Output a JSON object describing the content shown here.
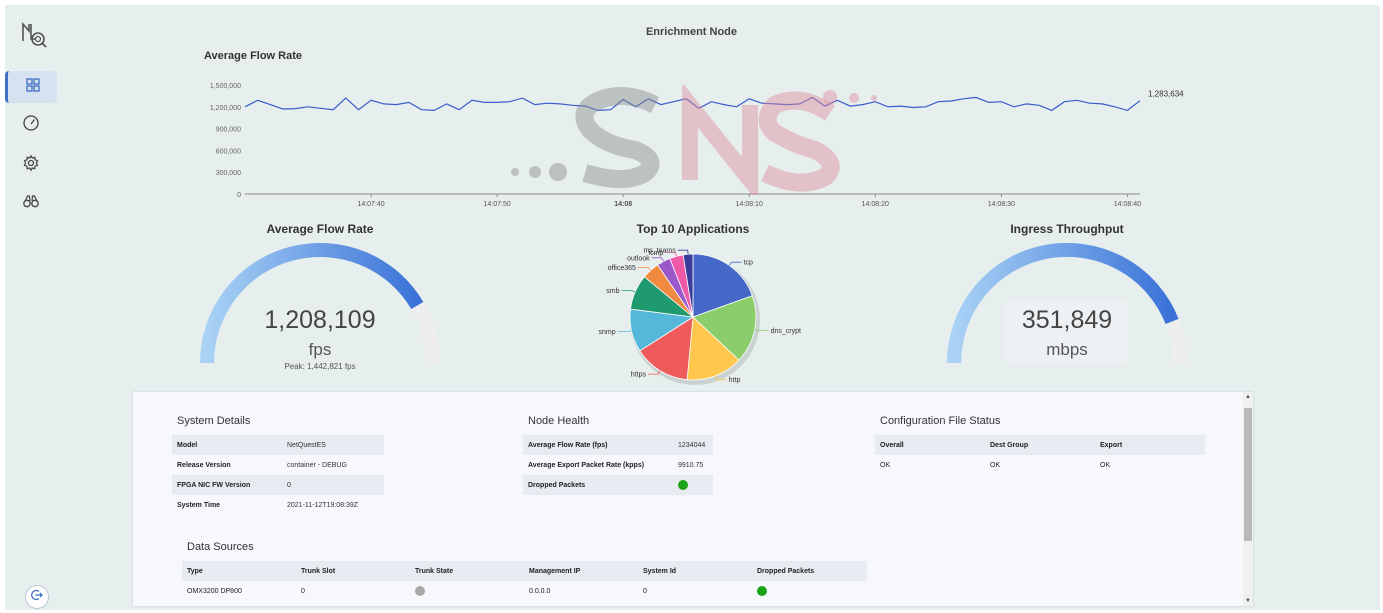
{
  "page": {
    "title": "Enrichment Node"
  },
  "sidebar": {
    "items": [
      {
        "name": "dashboard",
        "icon": "grid-icon",
        "active": true
      },
      {
        "name": "performance",
        "icon": "speedometer-icon",
        "active": false
      },
      {
        "name": "settings",
        "icon": "gear-icon",
        "active": false
      },
      {
        "name": "monitor",
        "icon": "binoculars-icon",
        "active": false
      }
    ],
    "logo_icon": "netquest-logo-icon",
    "logout_icon": "logout-icon"
  },
  "flow_chart": {
    "title": "Average Flow Rate",
    "y_ticks": [
      "1,500,000",
      "1,200,000",
      "900,000",
      "600,000",
      "300,000",
      "0"
    ],
    "x_ticks": [
      "14:07:40",
      "14:07:50",
      "14:08",
      "14:08:10",
      "14:08:20",
      "14:08:30",
      "14:08:40"
    ],
    "last_value_label": "1,283,634",
    "color": "#3b5ccc"
  },
  "chart_data": [
    {
      "type": "line",
      "title": "Average Flow Rate",
      "ylim": [
        0,
        1500000
      ],
      "x": [
        "14:07:30",
        "14:07:31",
        "14:07:32",
        "14:07:33",
        "14:07:34",
        "14:07:35",
        "14:07:36",
        "14:07:37",
        "14:07:38",
        "14:07:39",
        "14:07:40",
        "14:07:41",
        "14:07:42",
        "14:07:43",
        "14:07:44",
        "14:07:45",
        "14:07:46",
        "14:07:47",
        "14:07:48",
        "14:07:49",
        "14:07:50",
        "14:07:51",
        "14:07:52",
        "14:07:53",
        "14:07:54",
        "14:07:55",
        "14:07:56",
        "14:07:57",
        "14:07:58",
        "14:07:59",
        "14:08:00",
        "14:08:01",
        "14:08:02",
        "14:08:03",
        "14:08:04",
        "14:08:05",
        "14:08:06",
        "14:08:07",
        "14:08:08",
        "14:08:09",
        "14:08:10",
        "14:08:11",
        "14:08:12",
        "14:08:13",
        "14:08:14",
        "14:08:15",
        "14:08:16",
        "14:08:17",
        "14:08:18",
        "14:08:19",
        "14:08:20",
        "14:08:21",
        "14:08:22",
        "14:08:23",
        "14:08:24",
        "14:08:25",
        "14:08:26",
        "14:08:27",
        "14:08:28",
        "14:08:29",
        "14:08:30",
        "14:08:31",
        "14:08:32",
        "14:08:33",
        "14:08:34",
        "14:08:35",
        "14:08:36",
        "14:08:37",
        "14:08:38",
        "14:08:39",
        "14:08:40",
        "14:08:41"
      ],
      "series": [
        {
          "values": [
            1200000,
            1290000,
            1230000,
            1170000,
            1175000,
            1200000,
            1180000,
            1160000,
            1320000,
            1160000,
            1290000,
            1240000,
            1230000,
            1260000,
            1160000,
            1150000,
            1240000,
            1160000,
            1290000,
            1260000,
            1260000,
            1270000,
            1320000,
            1230000,
            1250000,
            1240000,
            1220000,
            1210000,
            1150000,
            1160000,
            1300000,
            1200000,
            1310000,
            1230000,
            1270000,
            1310000,
            1180000,
            1270000,
            1230000,
            1200000,
            1310000,
            1250000,
            1240000,
            1230000,
            1240000,
            1330000,
            1210000,
            1290000,
            1210000,
            1230000,
            1270000,
            1200000,
            1210000,
            1190000,
            1200000,
            1270000,
            1280000,
            1310000,
            1330000,
            1260000,
            1270000,
            1200000,
            1240000,
            1220000,
            1150000,
            1270000,
            1290000,
            1250000,
            1240000,
            1200000,
            1150000,
            1283634
          ]
        }
      ]
    },
    {
      "type": "pie",
      "title": "Top 10 Applications",
      "categories": [
        "tcp",
        "dns_crypt",
        "http",
        "https",
        "snmp",
        "smb",
        "office365",
        "outlook",
        "icmp",
        "ms_teams"
      ],
      "values": [
        19.5,
        17.5,
        14.5,
        14.5,
        11,
        9,
        4.5,
        3.5,
        3.5,
        2.5
      ],
      "colors": [
        "#4567c8",
        "#8bcd6a",
        "#ffc74d",
        "#ef5a5a",
        "#56b8d8",
        "#1f9a6e",
        "#f08a40",
        "#9a58c8",
        "#ef5aa8",
        "#3b3b9a"
      ]
    }
  ],
  "gauges": {
    "flow": {
      "title": "Average Flow Rate",
      "value": "1,208,109",
      "unit": "fps",
      "peak": "Peak: 1,442,821 fps",
      "fraction": 0.83
    },
    "ingress": {
      "title": "Ingress Throughput",
      "value": "351,849",
      "unit": "mbps",
      "fraction": 0.88
    }
  },
  "system_details": {
    "title": "System Details",
    "rows": [
      {
        "key": "Model",
        "value": "NetQuestES"
      },
      {
        "key": "Release Version",
        "value": "container - DEBUG"
      },
      {
        "key": "FPGA NIC FW Version",
        "value": "0"
      },
      {
        "key": "System Time",
        "value": "2021-11-12T19:08:39Z"
      }
    ]
  },
  "node_health": {
    "title": "Node Health",
    "rows": [
      {
        "key": "Average Flow Rate (fps)",
        "value": "1234044"
      },
      {
        "key": "Average Export Packet Rate (kpps)",
        "value": "9910.75"
      },
      {
        "key": "Dropped Packets",
        "status_color": "#1ba31b"
      }
    ]
  },
  "config_status": {
    "title": "Configuration File Status",
    "headers": [
      "Overall",
      "Dest Group",
      "Export"
    ],
    "values": [
      "OK",
      "OK",
      "OK"
    ]
  },
  "data_sources": {
    "title": "Data Sources",
    "headers": [
      "Type",
      "Trunk Slot",
      "Trunk State",
      "Management IP",
      "System Id",
      "Dropped Packets"
    ],
    "rows": [
      {
        "type": "OMX3200 DP800",
        "trunk_slot": "0",
        "trunk_state_color": "#a8a8a8",
        "management_ip": "0.0.0.0",
        "system_id": "0",
        "dropped_color": "#1ba31b"
      }
    ]
  }
}
